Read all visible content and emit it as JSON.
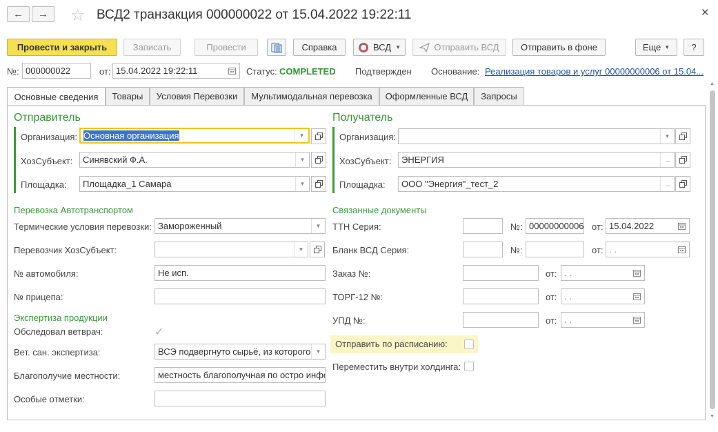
{
  "window": {
    "title": "ВСД2 транзакция 000000022 от 15.04.2022 19:22:11"
  },
  "nav": {
    "back_icon": "←",
    "forward_icon": "→",
    "star_icon": "☆",
    "close_icon": "✕"
  },
  "toolbar": {
    "post_close": "Провести и закрыть",
    "save": "Записать",
    "post": "Провести",
    "help": "Справка",
    "vsd": "ВСД",
    "send_vsd": "Отправить ВСД",
    "send_bg": "Отправить в фоне",
    "more": "Еще",
    "question": "?"
  },
  "header": {
    "number_label": "№:",
    "number_value": "000000022",
    "date_label": "от:",
    "date_value": "15.04.2022 19:22:11",
    "status_label": "Статус:",
    "status_value": "COMPLETED",
    "confirmed": "Подтвержден",
    "basis_label": "Основание:",
    "basis_link": "Реализация товаров и услуг 00000000006 от 15.04..."
  },
  "tabs": [
    {
      "label": "Основные сведения"
    },
    {
      "label": "Товары"
    },
    {
      "label": "Условия Перевозки"
    },
    {
      "label": "Мультимодальная перевозка"
    },
    {
      "label": "Оформленные ВСД"
    },
    {
      "label": "Запросы"
    }
  ],
  "sender": {
    "title": "Отправитель",
    "org_label": "Организация:",
    "org_value": "Основная организация",
    "entity_label": "ХозСубъект:",
    "entity_value": "Синявский Ф.А.",
    "site_label": "Площадка:",
    "site_value": "Площадка_1 Самара"
  },
  "receiver": {
    "title": "Получатель",
    "org_label": "Организация:",
    "org_value": "",
    "entity_label": "ХозСубъект:",
    "entity_value": "ЭНЕРГИЯ",
    "site_label": "Площадка:",
    "site_value": "ООО \"Энергия\"_тест_2"
  },
  "transport": {
    "title": "Перевозка Автотранспортом",
    "thermal_label": "Термические условия перевозки:",
    "thermal_value": "Замороженный",
    "carrier_label": "Перевозчик ХозСубъект:",
    "carrier_value": "",
    "car_label": "№ автомобиля:",
    "car_value": "Не исп.",
    "trailer_label": "№ прицепа:",
    "trailer_value": ""
  },
  "expertise": {
    "title": "Экспертиза продукции",
    "vet_label": "Обследовал ветврач:",
    "vet_checked": true,
    "vse_label": "Вет. сан. экспертиза:",
    "vse_value": "ВСЭ подвергнуто сырьё, из которого",
    "welfare_label": "Благополучие местности:",
    "welfare_value": "местность благополучная по остро инфе",
    "notes_label": "Особые отметки:",
    "notes_value": ""
  },
  "related": {
    "title": "Связанные документы",
    "ttn_label": "ТТН Серия:",
    "ttn_series": "",
    "ttn_no_label": "№:",
    "ttn_no": "00000000006",
    "ttn_from_label": "от:",
    "ttn_date": "15.04.2022",
    "blank_label": "Бланк ВСД Серия:",
    "blank_series": "",
    "blank_no_label": "№:",
    "blank_no": "",
    "blank_from_label": "от:",
    "blank_date": " .  .",
    "order_label": "Заказ №:",
    "order_no": "",
    "order_from_label": "от:",
    "order_date": " .  .",
    "torg_label": "ТОРГ-12 №:",
    "torg_no": "",
    "torg_from_label": "от:",
    "torg_date": " .  .",
    "upd_label": "УПД №:",
    "upd_no": "",
    "upd_from_label": "от:",
    "upd_date": " .  .",
    "schedule_label": "Отправить по расписанию:",
    "schedule_checked": false,
    "holding_label": "Переместить внутри холдинга:",
    "holding_checked": false
  },
  "colors": {
    "accent": "#3a9a3a",
    "primary_button": "#f5e04f",
    "link": "#1a55b0",
    "focus": "#f0c419"
  }
}
